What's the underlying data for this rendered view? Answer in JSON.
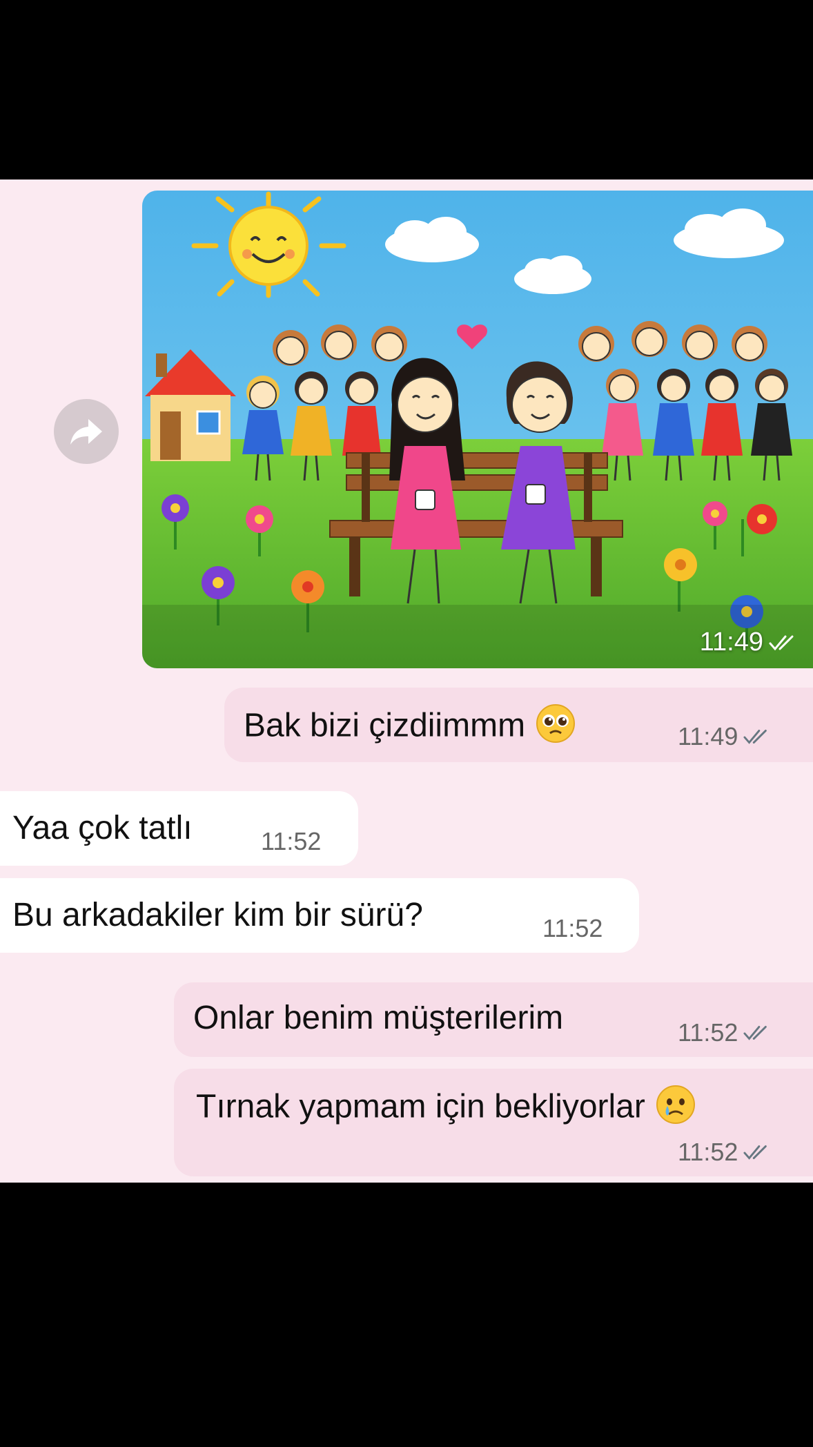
{
  "messages": [
    {
      "id": "m0",
      "type": "image",
      "direction": "outgoing",
      "time": "11:49",
      "status": "read",
      "image_alt": "Child-like crayon drawing: two girls with mugs on a park bench, a crowd of waving girls behind, a smiling sun, clouds, a house and flowers"
    },
    {
      "id": "m1",
      "direction": "outgoing",
      "text": "Bak bizi çizdiimmm",
      "emoji": "pleading-face-icon",
      "time": "11:49",
      "status": "read"
    },
    {
      "id": "m2",
      "direction": "incoming",
      "text": "Yaa çok tatlı",
      "time": "11:52"
    },
    {
      "id": "m3",
      "direction": "incoming",
      "text": "Bu arkadakiler kim bir sürü?",
      "time": "11:52"
    },
    {
      "id": "m4",
      "direction": "outgoing",
      "text": "Onlar benim müşterilerim",
      "time": "11:52",
      "status": "read"
    },
    {
      "id": "m5",
      "direction": "outgoing",
      "text": "Tırnak yapmam için bekliyorlar",
      "emoji": "sad-tear-face-icon",
      "time": "11:52",
      "status": "read"
    }
  ],
  "icons": {
    "forward": "forward-arrow-icon",
    "read": "double-check-icon"
  },
  "colors": {
    "chat_bg": "#fbeaf1",
    "outgoing_bubble": "#f7dde8",
    "incoming_bubble": "#ffffff",
    "tick_read": "#667781"
  }
}
